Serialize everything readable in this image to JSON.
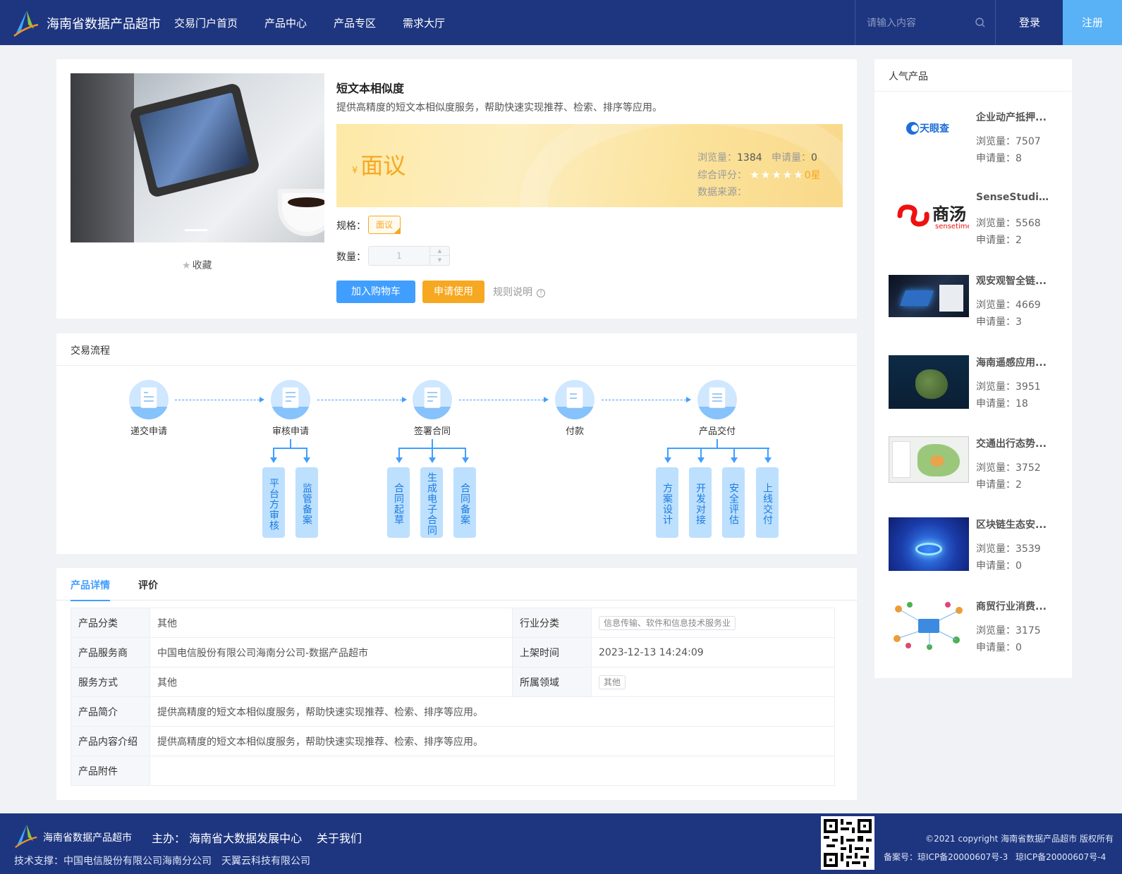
{
  "header": {
    "site_title": "海南省数据产品超市",
    "nav": [
      "交易门户首页",
      "产品中心",
      "产品专区",
      "需求大厅"
    ],
    "search_placeholder": "请输入内容",
    "login": "登录",
    "register": "注册",
    "colors": {
      "bg": "#1e3680",
      "register_bg": "#58b2f5"
    }
  },
  "product": {
    "favorite": "收藏",
    "title": "短文本相似度",
    "description": "提供高精度的短文本相似度服务，帮助快速实现推荐、检索、排序等应用。",
    "currency": "¥",
    "price": "面议",
    "views_label": "浏览量：",
    "views": "1384",
    "apply_label": "申请量：",
    "apply": "0",
    "rating_label": "综合评分：",
    "rating_stars": "★★★★★",
    "rating_value": "0星",
    "source_label": "数据来源：",
    "spec_label": "规格：",
    "spec_value": "面议",
    "qty_label": "数量：",
    "qty_value": "1",
    "add_cart": "加入购物车",
    "apply_use": "申请使用",
    "rules": "规则说明"
  },
  "process": {
    "title": "交易流程",
    "steps": [
      "递交申请",
      "审核申请",
      "签署合同",
      "付款",
      "产品交付"
    ],
    "sub_review": [
      "平台方审核",
      "监管备案"
    ],
    "sub_contract": [
      "合同起草",
      "生成电子合同",
      "合同备案"
    ],
    "sub_delivery": [
      "方案设计",
      "开发对接",
      "安全评估",
      "上线交付"
    ]
  },
  "details": {
    "tabs": [
      "产品详情",
      "评价"
    ],
    "rows": [
      {
        "k1": "产品分类",
        "v1": "其他",
        "k2": "行业分类",
        "v2": "信息传输、软件和信息技术服务业"
      },
      {
        "k1": "产品服务商",
        "v1": "中国电信股份有限公司海南分公司-数据产品超市",
        "k2": "上架时间",
        "v2": "2023-12-13 14:24:09"
      },
      {
        "k1": "服务方式",
        "v1": "其他",
        "k2": "所属领域",
        "v2": "其他"
      }
    ],
    "intro_label": "产品简介",
    "intro": "提供高精度的短文本相似度服务，帮助快速实现推荐、检索、排序等应用。",
    "content_label": "产品内容介绍",
    "content": "提供高精度的短文本相似度服务，帮助快速实现推荐、检索、排序等应用。",
    "attach_label": "产品附件"
  },
  "sidebar": {
    "title": "人气产品",
    "views_label": "浏览量：",
    "apply_label": "申请量：",
    "items": [
      {
        "name": "企业动产抵押...",
        "views": "7507",
        "apply": "8",
        "brand": "天眼查"
      },
      {
        "name": "SenseStudio...",
        "views": "5568",
        "apply": "2",
        "brand": "商汤",
        "brand_sub": "sensetime"
      },
      {
        "name": "观安观智全链...",
        "views": "4669",
        "apply": "3"
      },
      {
        "name": "海南遥感应用...",
        "views": "3951",
        "apply": "18"
      },
      {
        "name": "交通出行态势...",
        "views": "3752",
        "apply": "2"
      },
      {
        "name": "区块链生态安...",
        "views": "3539",
        "apply": "0"
      },
      {
        "name": "商贸行业消费...",
        "views": "3175",
        "apply": "0"
      }
    ]
  },
  "footer": {
    "site": "海南省数据产品超市",
    "host": "主办： 海南省大数据发展中心",
    "about": "关于我们",
    "tech_support": "技术支撑：中国电信股份有限公司海南分公司",
    "tech_support2": "天翼云科技有限公司",
    "copyright": "©2021 copyright 海南省数据产品超市 版权所有",
    "icp1": "备案号：琼ICP备20000607号-3",
    "icp2": "琼ICP备20000607号-4"
  }
}
